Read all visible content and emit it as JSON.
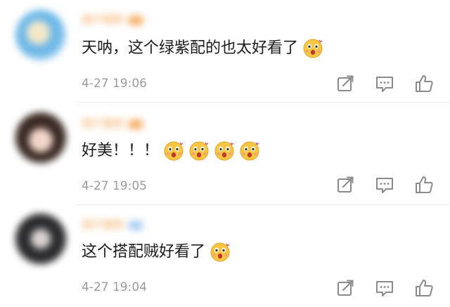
{
  "icons": {
    "share": "share-icon",
    "comment": "comment-icon",
    "like": "like-icon",
    "emoji": "emoji-icon"
  },
  "colors": {
    "username": "#f29a45",
    "time": "#9b9b9b",
    "text": "#1b1b1b",
    "icon": "#8a8a8a"
  },
  "comments": [
    {
      "text": "天呐，这个绿紫配的也太好看了",
      "time": "4-27 19:06",
      "emoji_count": 1
    },
    {
      "text": "好美！！！",
      "time": "4-27 19:05",
      "emoji_count": 4
    },
    {
      "text": "这个搭配贼好看了",
      "time": "4-27 19:04",
      "emoji_count": 1
    }
  ]
}
